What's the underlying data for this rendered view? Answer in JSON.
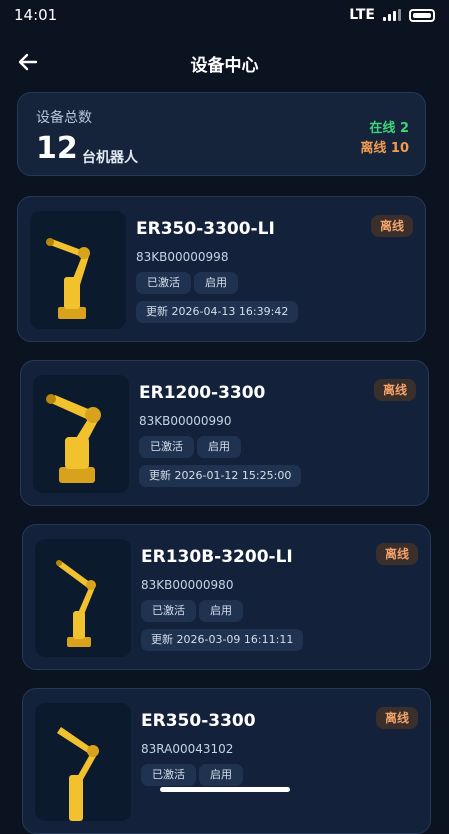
{
  "status": {
    "time": "14:01",
    "network": "LTE"
  },
  "header": {
    "title": "设备中心",
    "back_icon": "arrow-left-icon"
  },
  "summary": {
    "label": "设备总数",
    "count": "12",
    "unit": "台机器人",
    "online": "在线 2",
    "offline": "离线 10"
  },
  "devices": [
    {
      "model": "ER350-3300-LI",
      "serial": "83KB00000998",
      "tag1": "已激活",
      "tag2": "启用",
      "updated": "更新 2026-04-13 16:39:42",
      "status": "离线"
    },
    {
      "model": "ER1200-3300",
      "serial": "83KB00000990",
      "tag1": "已激活",
      "tag2": "启用",
      "updated": "更新 2026-01-12 15:25:00",
      "status": "离线"
    },
    {
      "model": "ER130B-3200-LI",
      "serial": "83KB00000980",
      "tag1": "已激活",
      "tag2": "启用",
      "updated": "更新 2026-03-09 16:11:11",
      "status": "离线"
    },
    {
      "model": "ER350-3300",
      "serial": "83RA00043102",
      "tag1": "已激活",
      "tag2": "启用",
      "updated": "",
      "status": "离线"
    }
  ],
  "colors": {
    "background": "#0b1220",
    "card": "#13223a",
    "online": "#3fd37a",
    "offline": "#f39a4d",
    "robot": "#f2c12e"
  }
}
